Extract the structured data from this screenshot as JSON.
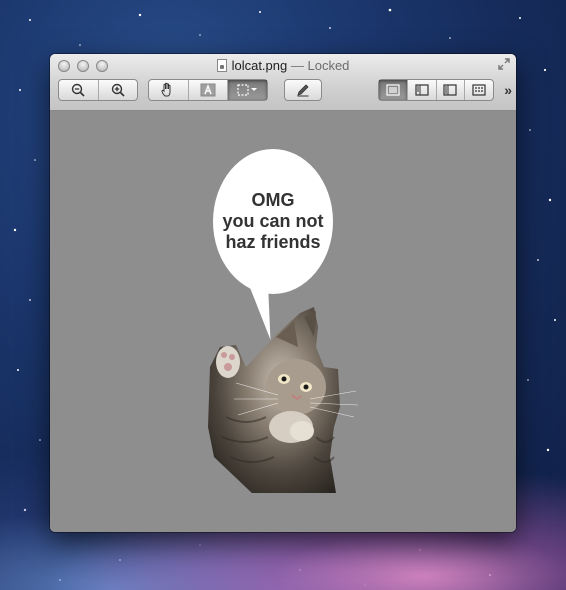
{
  "window": {
    "title_file": "lolcat.png",
    "title_separator": "—",
    "title_status": "Locked"
  },
  "toolbar": {
    "zoom_out_icon": "zoom-out-icon",
    "zoom_in_icon": "zoom-in-icon",
    "hand_icon": "hand-icon",
    "text_select_icon": "text-select-icon",
    "rect_select_icon": "rectangular-selection-icon",
    "annotate_icon": "pencil-icon",
    "view_icons": [
      "single-page-icon",
      "sidebar-left-icon",
      "sidebar-right-icon",
      "contact-sheet-icon"
    ],
    "overflow_label": "»"
  },
  "image": {
    "speech_lines": [
      "OMG",
      "you can not",
      "haz friends"
    ]
  }
}
